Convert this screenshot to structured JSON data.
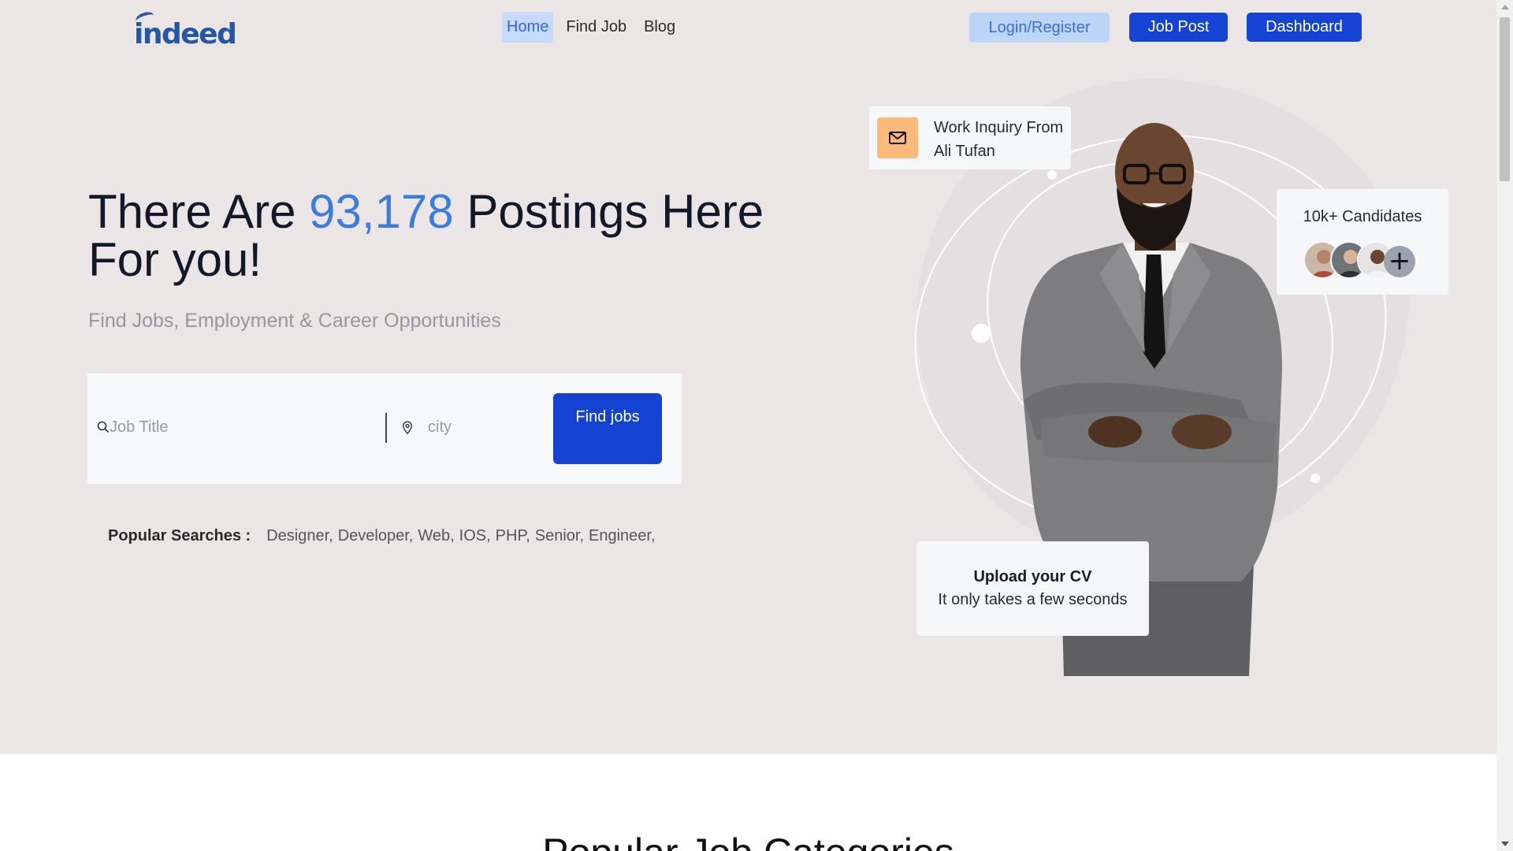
{
  "brand": {
    "logo_text": "indeed",
    "primary_color": "#1543d4",
    "accent_color": "#3b7ddd",
    "hero_bg": "#ebe5e6"
  },
  "nav": {
    "items": [
      {
        "label": "Home",
        "active": true
      },
      {
        "label": "Find Job",
        "active": false
      },
      {
        "label": "Blog",
        "active": false
      }
    ]
  },
  "header_buttons": {
    "login": "Login/Register",
    "job_post": "Job Post",
    "dashboard": "Dashboard"
  },
  "hero": {
    "headline_prefix": "There Are ",
    "postings_count": "93,178",
    "headline_suffix": " Postings Here For you!",
    "subheadline": "Find Jobs, Employment & Career Opportunities"
  },
  "search": {
    "job_placeholder": "Job Title",
    "city_placeholder": "city",
    "find_button": "Find jobs",
    "icons": {
      "job": "search-icon",
      "city": "map-pin-icon"
    }
  },
  "popular_searches": {
    "label": "Popular Searches :",
    "tags": [
      "Designer,",
      "Developer,",
      "Web,",
      "IOS,",
      "PHP,",
      "Senior,",
      "Engineer,"
    ]
  },
  "cards": {
    "inquiry": {
      "icon": "mail-icon",
      "line1": "Work Inquiry From",
      "line2": "Ali Tufan"
    },
    "candidates": {
      "title": "10k+ Candidates",
      "plus_icon": "plus-icon"
    },
    "upload_cv": {
      "title": "Upload your CV",
      "subtitle": "It only takes a few seconds"
    }
  },
  "next_section": {
    "title": "Popular Job Categories"
  }
}
